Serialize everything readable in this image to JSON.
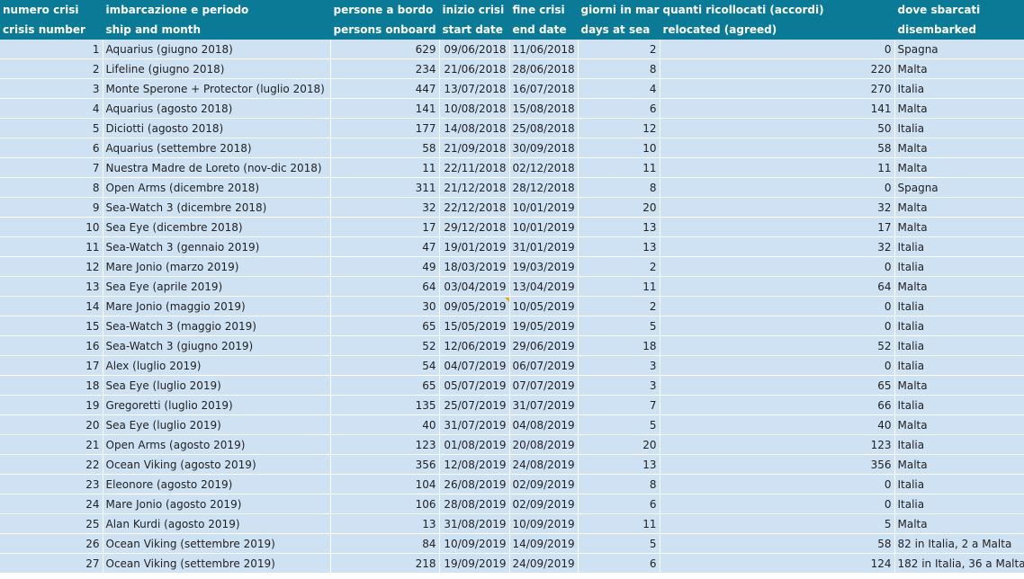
{
  "headers": {
    "row1": [
      "numero crisi",
      "imbarcazione e periodo",
      "persone a bordo",
      "inizio crisi",
      "fine crisi",
      "giorni in mare",
      "quanti ricollocati (accordi)",
      "dove sbarcati"
    ],
    "row2": [
      "crisis number",
      "ship and month",
      "persons onboard",
      "start date",
      "end date",
      "days at sea",
      "relocated (agreed)",
      "disembarked"
    ]
  },
  "rows": [
    [
      "1",
      "Aquarius (giugno 2018)",
      "629",
      "09/06/2018",
      "11/06/2018",
      "2",
      "0",
      "Spagna"
    ],
    [
      "2",
      "Lifeline (giugno 2018)",
      "234",
      "21/06/2018",
      "28/06/2018",
      "8",
      "220",
      "Malta"
    ],
    [
      "3",
      "Monte Sperone + Protector (luglio 2018)",
      "447",
      "13/07/2018",
      "16/07/2018",
      "4",
      "270",
      "Italia"
    ],
    [
      "4",
      "Aquarius (agosto 2018)",
      "141",
      "10/08/2018",
      "15/08/2018",
      "6",
      "141",
      "Malta"
    ],
    [
      "5",
      "Diciotti (agosto 2018)",
      "177",
      "14/08/2018",
      "25/08/2018",
      "12",
      "50",
      "Italia"
    ],
    [
      "6",
      "Aquarius (settembre 2018)",
      "58",
      "21/09/2018",
      "30/09/2018",
      "10",
      "58",
      "Malta"
    ],
    [
      "7",
      "Nuestra Madre de Loreto (nov-dic 2018)",
      "11",
      "22/11/2018",
      "02/12/2018",
      "11",
      "11",
      "Malta"
    ],
    [
      "8",
      "Open Arms (dicembre 2018)",
      "311",
      "21/12/2018",
      "28/12/2018",
      "8",
      "0",
      "Spagna"
    ],
    [
      "9",
      "Sea-Watch 3 (dicembre 2018)",
      "32",
      "22/12/2018",
      "10/01/2019",
      "20",
      "32",
      "Malta"
    ],
    [
      "10",
      "Sea Eye (dicembre 2018)",
      "17",
      "29/12/2018",
      "10/01/2019",
      "13",
      "17",
      "Malta"
    ],
    [
      "11",
      "Sea-Watch 3 (gennaio 2019)",
      "47",
      "19/01/2019",
      "31/01/2019",
      "13",
      "32",
      "Italia"
    ],
    [
      "12",
      "Mare Jonio (marzo 2019)",
      "49",
      "18/03/2019",
      "19/03/2019",
      "2",
      "0",
      "Italia"
    ],
    [
      "13",
      "Sea Eye (aprile 2019)",
      "64",
      "03/04/2019",
      "13/04/2019",
      "11",
      "64",
      "Malta"
    ],
    [
      "14",
      "Mare Jonio (maggio 2019)",
      "30",
      "09/05/2019",
      "10/05/2019",
      "2",
      "0",
      "Italia"
    ],
    [
      "15",
      "Sea-Watch 3 (maggio 2019)",
      "65",
      "15/05/2019",
      "19/05/2019",
      "5",
      "0",
      "Italia"
    ],
    [
      "16",
      "Sea-Watch 3 (giugno 2019)",
      "52",
      "12/06/2019",
      "29/06/2019",
      "18",
      "52",
      "Italia"
    ],
    [
      "17",
      "Alex (luglio 2019)",
      "54",
      "04/07/2019",
      "06/07/2019",
      "3",
      "0",
      "Italia"
    ],
    [
      "18",
      "Sea Eye (luglio 2019)",
      "65",
      "05/07/2019",
      "07/07/2019",
      "3",
      "65",
      "Malta"
    ],
    [
      "19",
      "Gregoretti (luglio 2019)",
      "135",
      "25/07/2019",
      "31/07/2019",
      "7",
      "66",
      "Italia"
    ],
    [
      "20",
      "Sea Eye (luglio 2019)",
      "40",
      "31/07/2019",
      "04/08/2019",
      "5",
      "40",
      "Malta"
    ],
    [
      "21",
      "Open Arms (agosto 2019)",
      "123",
      "01/08/2019",
      "20/08/2019",
      "20",
      "123",
      "Italia"
    ],
    [
      "22",
      "Ocean Viking (agosto 2019)",
      "356",
      "12/08/2019",
      "24/08/2019",
      "13",
      "356",
      "Malta"
    ],
    [
      "23",
      "Eleonore (agosto 2019)",
      "104",
      "26/08/2019",
      "02/09/2019",
      "8",
      "0",
      "Italia"
    ],
    [
      "24",
      "Mare Jonio (agosto 2019)",
      "106",
      "28/08/2019",
      "02/09/2019",
      "6",
      "0",
      "Italia"
    ],
    [
      "25",
      "Alan Kurdi (agosto 2019)",
      "13",
      "31/08/2019",
      "10/09/2019",
      "11",
      "5",
      "Malta"
    ],
    [
      "26",
      "Ocean Viking (settembre 2019)",
      "84",
      "10/09/2019",
      "14/09/2019",
      "5",
      "58",
      "82 in Italia, 2 a Malta"
    ],
    [
      "27",
      "Ocean Viking (settembre 2019)",
      "218",
      "19/09/2019",
      "24/09/2019",
      "6",
      "124",
      "182 in Italia, 36 a Malta"
    ]
  ],
  "colors": {
    "header_bg": "#0a7a96",
    "header_text": "#ffffff",
    "cell_bg": "#cfe2f3",
    "comment_marker": "#e6a800"
  }
}
